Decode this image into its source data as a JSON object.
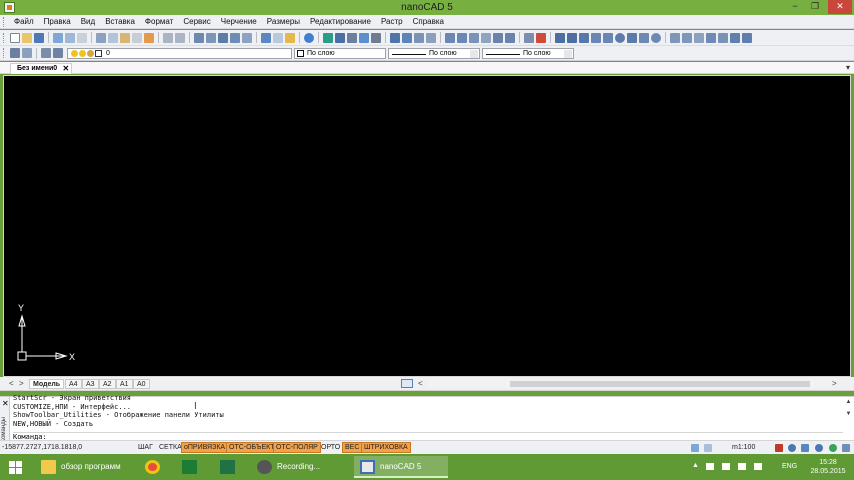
{
  "window": {
    "title": "nanoCAD 5",
    "minimize_glyph": "−",
    "maximize_glyph": "❐",
    "close_glyph": "✕"
  },
  "menu": {
    "items": [
      "Файл",
      "Правка",
      "Вид",
      "Вставка",
      "Формат",
      "Сервис",
      "Черчение",
      "Размеры",
      "Редактирование",
      "Растр",
      "Справка"
    ]
  },
  "properties_toolbar": {
    "layer_value": "0",
    "color_value": "По слою",
    "linetype_value": "По слою",
    "lineweight_value": "По слою"
  },
  "document_tabs": [
    {
      "label": "Без имени0",
      "close": "✕"
    }
  ],
  "canvas": {
    "background": "#000000",
    "ucs_y_label": "Y",
    "ucs_x_label": "X"
  },
  "layout_tabs": [
    "Модель",
    "A4",
    "A3",
    "A2",
    "A1",
    "A0"
  ],
  "layout_nav": {
    "prev": "<",
    "next": ">"
  },
  "hscroll": {
    "left": "<",
    "right": ">"
  },
  "command_window": {
    "side_title": "Команды",
    "close": "✕",
    "lines": [
      "StartScr - Экран приветствия",
      "CUSTOMIZE,НПИ - Интерфейс...",
      "ShowToolbar_Utilities - Отображение панели Утилиты",
      "NEW,НОВЫЙ - Создать"
    ],
    "prompt": "Команда:"
  },
  "status_bar": {
    "coordinates": "-15877.2727,1718.1818,0",
    "toggles": [
      {
        "label": "ШАГ",
        "on": false
      },
      {
        "label": "СЕТКА",
        "on": false
      },
      {
        "label": "оПРИВЯЗКА",
        "on": true
      },
      {
        "label": "ОТС-ОБЪЕКТ",
        "on": true
      },
      {
        "label": "ОТС-ПОЛЯР",
        "on": true
      },
      {
        "label": "ОРТО",
        "on": false
      },
      {
        "label": "ВЕС",
        "on": true
      },
      {
        "label": "ШТРИХОВКА",
        "on": true
      }
    ],
    "scale": "m1:100"
  },
  "taskbar": {
    "items": [
      {
        "label": "обзор программ",
        "icon": "folder-icon"
      },
      {
        "label": "",
        "icon": "chrome-icon"
      },
      {
        "label": "",
        "icon": "spreadsheet-icon"
      },
      {
        "label": "",
        "icon": "excel-icon"
      },
      {
        "label": "Recording...",
        "icon": "recorder-icon"
      },
      {
        "label": "nanoCAD 5",
        "icon": "nanocad-icon"
      }
    ],
    "language": "ENG",
    "time": "15:28",
    "date": "28.05.2015"
  },
  "colors": {
    "accent_green": "#77b041",
    "taskbar_green": "#5f9a34",
    "toggle_on": "#f4a24a",
    "close_red": "#c9463b"
  }
}
